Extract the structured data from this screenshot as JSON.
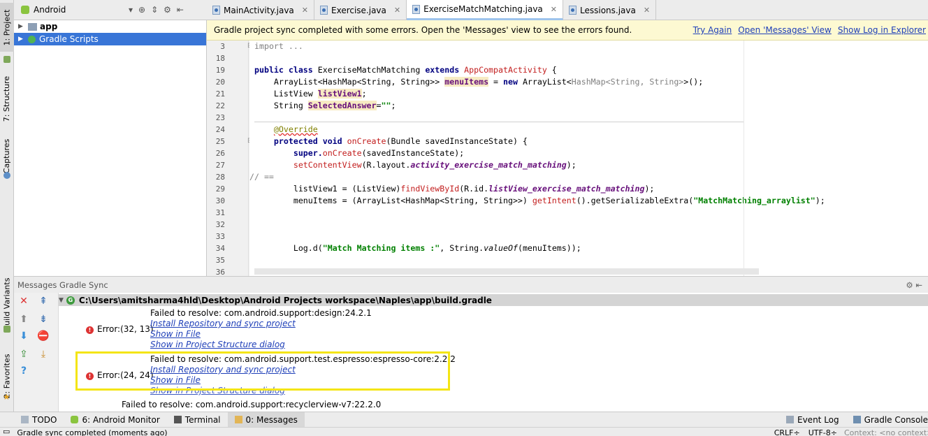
{
  "sidebar_tabs": {
    "project": "1: Project",
    "structure": "7: Structure",
    "captures": "Captures",
    "build_variants": "Build Variants",
    "favorites": "2: Favorites"
  },
  "project_panel": {
    "view_mode": "Android",
    "tree": [
      {
        "label": "app"
      },
      {
        "label": "Gradle Scripts"
      }
    ]
  },
  "editor_tabs": [
    {
      "label": "MainActivity.java"
    },
    {
      "label": "Exercise.java"
    },
    {
      "label": "ExerciseMatchMatching.java"
    },
    {
      "label": "Lessions.java"
    }
  ],
  "banner": {
    "message": "Gradle project sync completed with some errors. Open the 'Messages' view to see the errors found.",
    "try_again": "Try Again",
    "open_messages": "Open 'Messages' View",
    "show_log": "Show Log in Explorer"
  },
  "line_numbers": [
    "3",
    "18",
    "19",
    "20",
    "21",
    "22",
    "23",
    "24",
    "25",
    "26",
    "27",
    "28",
    "29",
    "30",
    "31",
    "32",
    "33",
    "34",
    "35",
    "36"
  ],
  "code": {
    "l3a": "import ",
    "l3b": "...",
    "l19a": "public class ",
    "l19b": "ExerciseMatchMatching ",
    "l19c": "extends ",
    "l19d": "AppCompatActivity",
    " l19e": " {",
    "l20a": "    ArrayList<HashMap<String, String>> ",
    "l20b": "menuItems",
    " l20c": " = ",
    "l20d": "new ",
    "l20e": "ArrayList<",
    "l20f": "HashMap<String, String>",
    "l20g": ">();",
    "l21a": "    ListView ",
    "l21b": "listView1",
    "l21c": ";",
    "l22a": "    String ",
    "l22b": "SelectedAnswer",
    "l22c": "=",
    "l22d": "\"\"",
    "l22e": ";",
    "l24a": "    ",
    "l24b": "@Override",
    "l25a": "    protected void ",
    "l25b": "onCreate",
    "l25c": "(Bundle savedInstanceState) {",
    "l26a": "        super.",
    "l26b": "onCreate",
    "l26c": "(savedInstanceState);",
    "l27a": "        setContentView",
    "l27b": "(R.layout.",
    "l27c": "activity_exercise_match_matching",
    "l27d": ");",
    "l28": "// ==",
    "l29a": "        listView1",
    " l29b": " = (ListView)",
    "l29c": "findViewById",
    "l29d": "(R.id.",
    "l29e": "listView_exercise_match_matching",
    "l29f": ");",
    "l30a": "        menuItems",
    " l30b": " = (ArrayList<HashMap<String, String>>) ",
    "l30c": "getIntent",
    "l30d": "().getSerializableExtra(",
    "l30e": "\"MatchMatching_arraylist\"",
    "l30f": ");",
    "l34a": "        Log.d(",
    "l34b": "\"Match Matching items :\"",
    "l34c": ", String.",
    "l34d": "valueOf",
    "l34e": "(menuItems));"
  },
  "messages": {
    "header": "Messages Gradle Sync",
    "file_path": "C:\\Users\\amitsharma4hld\\Desktop\\Android Projects workspace\\Naples\\app\\build.gradle",
    "errors": [
      {
        "location": "Error:(32, 13)",
        "text": "Failed to resolve: com.android.support:design:24.2.1",
        "links": [
          "Install Repository and sync project",
          "Show in File",
          "Show in Project Structure dialog"
        ]
      },
      {
        "location": "Error:(24, 24)",
        "text": "Failed to resolve: com.android.support.test.espresso:espresso-core:2.2.2",
        "links": [
          "Install Repository and sync project",
          "Show in File",
          "Show in Project Structure dialog"
        ]
      }
    ],
    "trailing": "Failed to resolve: com.android.support:recyclerview-v7:22.2.0"
  },
  "bottom_tabs": [
    {
      "label": "TODO"
    },
    {
      "label": "6: Android Monitor"
    },
    {
      "label": "Terminal"
    },
    {
      "label": "0: Messages"
    }
  ],
  "right_tabs": [
    {
      "label": "Event Log"
    },
    {
      "label": "Gradle Console"
    }
  ],
  "status": {
    "text": "Gradle sync completed (moments ago)",
    "line_sep": "CRLF÷",
    "encoding": "UTF-8÷",
    "context": "Context: <no context>"
  },
  "colors": {
    "accent_selected": "#3875d7",
    "banner_bg": "#fdf9d2",
    "highlight_box": "#f4e514",
    "link": "#1e3fb8",
    "error": "#dd3333"
  }
}
